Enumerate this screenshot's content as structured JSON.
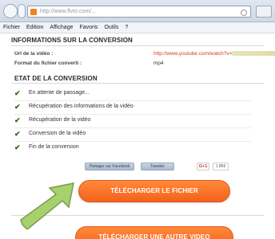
{
  "browser": {
    "url": "http://www.flvto.com/...",
    "menu": [
      "Fichier",
      "Edition",
      "Affichage",
      "Favoris",
      "Outils",
      "?"
    ]
  },
  "info": {
    "title": "INFORMATIONS SUR LA CONVERSION",
    "url_label": "Url de la vidéo :",
    "url_value": "http://www.youtube.com/watch?v=",
    "format_label": "Format du fichier converti :",
    "format_value": "mp4"
  },
  "status": {
    "title": "ETAT DE LA CONVERSION",
    "steps": [
      {
        "label": "En attente de passage..."
      },
      {
        "label": "Récupération des informations de la vidéo"
      },
      {
        "label": "Récupération de la vidéo"
      },
      {
        "label": "Conversion de la vidéo"
      },
      {
        "label": "Fin de la conversion"
      }
    ]
  },
  "social": {
    "share_label": "Partager sur Facebook",
    "tweet_label": "Tweeter",
    "gplus_label": "G+1",
    "gplus_count": "1 866"
  },
  "actions": {
    "download_label": "TÉLÉCHARGER LE FICHIER",
    "another_label": "TÉLÉCHARGER UNE AUTRE VIDEO"
  },
  "colors": {
    "accent": "#f4611a",
    "link": "#d93b1e",
    "check": "#2b6a18",
    "arrow": "#a6d16c"
  }
}
